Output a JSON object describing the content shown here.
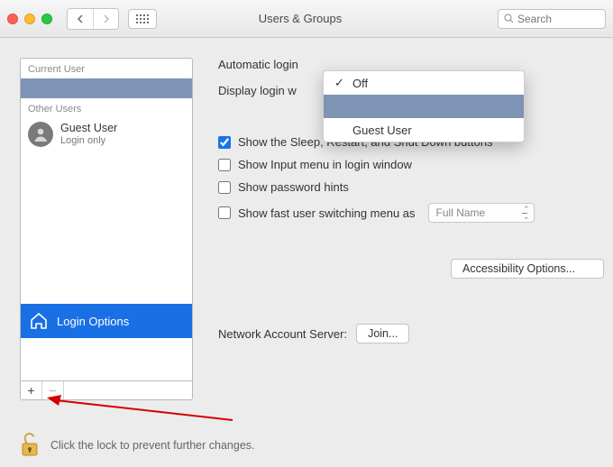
{
  "window": {
    "title": "Users & Groups",
    "search_placeholder": "Search"
  },
  "sidebar": {
    "current_label": "Current User",
    "other_label": "Other Users",
    "guest": {
      "name": "Guest User",
      "sub": "Login only"
    },
    "login_options_label": "Login Options"
  },
  "main": {
    "auto_login_label": "Automatic login",
    "display_login_label": "Display login w",
    "cb_sleep": "Show the Sleep, Restart, and Shut Down buttons",
    "cb_input": "Show Input menu in login window",
    "cb_hints": "Show password hints",
    "cb_fast": "Show fast user switching menu as",
    "fast_value": "Full Name",
    "accessibility_btn": "Accessibility Options...",
    "net_label": "Network Account Server:",
    "join_btn": "Join..."
  },
  "dropdown": {
    "opt_off": "Off",
    "opt_guest": "Guest User"
  },
  "lock": {
    "text": "Click the lock to prevent further changes."
  },
  "colors": {
    "accent": "#1970e4"
  }
}
